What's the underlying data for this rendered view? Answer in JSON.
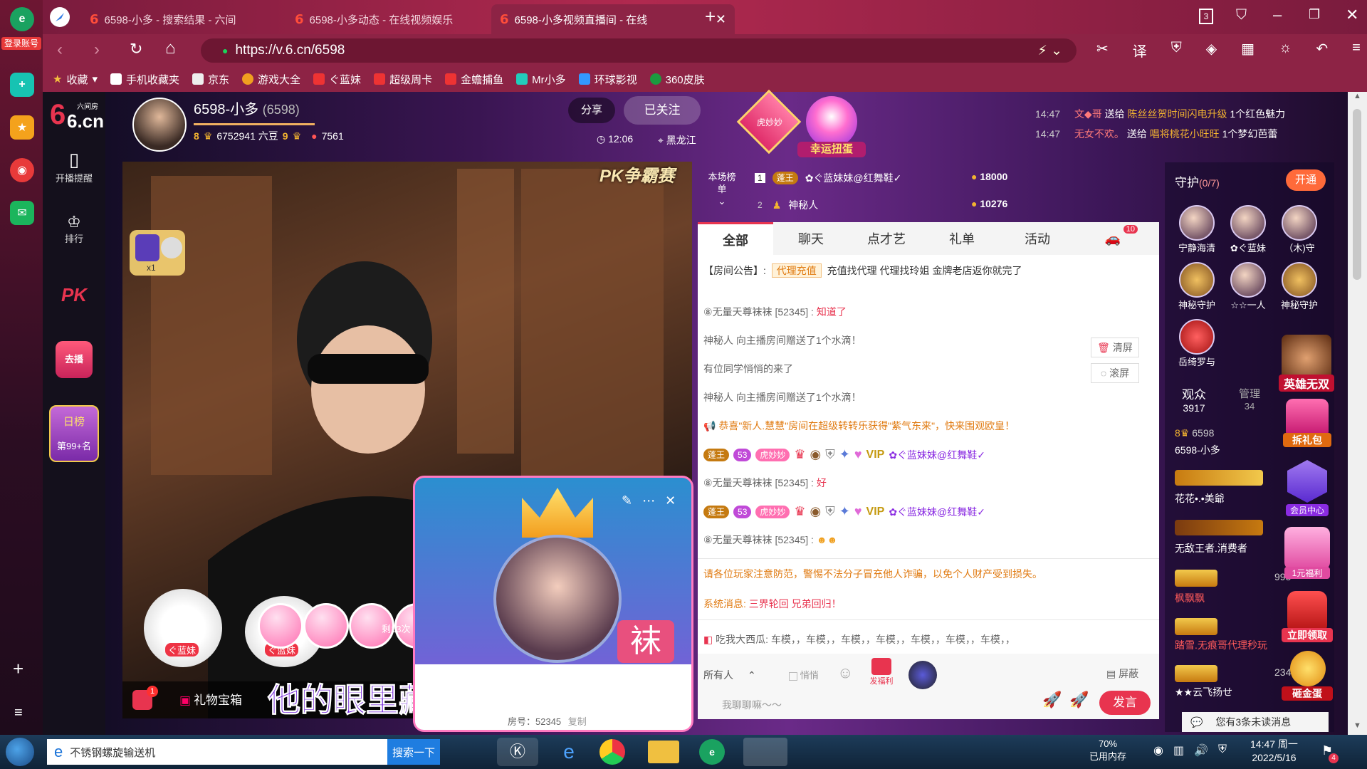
{
  "browser": {
    "tabs": [
      {
        "label": "6598-小多 - 搜索结果 - 六间",
        "active": false
      },
      {
        "label": "6598-小多动态 - 在线视频娱乐",
        "active": false
      },
      {
        "label": "6598-小多视频直播间 - 在线",
        "active": true
      }
    ],
    "url": "https://v.6.cn/6598",
    "tab_count": "3",
    "login_label": "登录账号",
    "bookmarks": [
      "收藏",
      "手机收藏夹",
      "京东",
      "游戏大全",
      "ぐ蓝妹",
      "超级周卡",
      "金蟾捕鱼",
      "Mr小多",
      "环球影视",
      "360皮肤"
    ]
  },
  "site": {
    "logo_main": "6.cn",
    "logo_small": "六间房",
    "nav": {
      "alert": "开播提醒",
      "rank": "排行",
      "pk": "PK",
      "live": "去播",
      "daily": "日榜",
      "daily_rank": "第99+名"
    }
  },
  "host": {
    "name": "6598-小多",
    "room_id": "(6598)",
    "level_left": "8",
    "beans": "6752941 六豆",
    "level_right": "9",
    "fans": "7561",
    "share_label": "分享",
    "follow_label": "已关注",
    "time": "12:06",
    "location": "黑龙江",
    "event_badge": "虎妙妙",
    "lucky_label": "幸运扭蛋"
  },
  "ticker": [
    {
      "time": "14:47",
      "sender": "文◆哥",
      "action": "送给",
      "receiver": "陈丝丝贺时间闪电升级",
      "gift": "1个红色魅力"
    },
    {
      "time": "14:47",
      "sender": "无女不欢。",
      "action": "送给",
      "receiver": "唱将桃花小旺旺",
      "gift": "1个梦幻芭蕾"
    }
  ],
  "ranking": {
    "label": "本场榜单",
    "rows": [
      {
        "rank": "1",
        "badge": "蓬王",
        "name": "✿ぐ蓝妹妹@红舞鞋✓",
        "score": "18000"
      },
      {
        "rank": "2",
        "badge": "",
        "name": "神秘人",
        "score": "10276"
      }
    ]
  },
  "chat": {
    "tabs": [
      "全部",
      "聊天",
      "点才艺",
      "礼单",
      "活动"
    ],
    "car_badge": "10",
    "notice_prefix": "【房间公告】:",
    "notice_tag": "代理充值",
    "notice_text": "充值找代理 代理找玲姐 金牌老店返你就完了",
    "lines": [
      {
        "type": "user",
        "name": "无量天尊袜袜 [52345]",
        "text": "知道了"
      },
      {
        "type": "system",
        "text": "神秘人 向主播房间赠送了1个水滴！"
      },
      {
        "type": "system",
        "text": "有位同学悄悄的来了"
      },
      {
        "type": "system",
        "text": "神秘人 向主播房间赠送了1个水滴！"
      },
      {
        "type": "congrats",
        "text": "恭喜\"新人.慧慧\"房间在超级转转乐获得\"紫气东来\"，快来围观欧皇！"
      },
      {
        "type": "badge_row",
        "badge": "蓬王",
        "level": "53",
        "tag": "虎妙妙",
        "name": "✿ぐ蓝妹妹@红舞鞋✓"
      },
      {
        "type": "user",
        "name": "无量天尊袜袜 [52345]",
        "text": "好"
      },
      {
        "type": "badge_row",
        "badge": "蓬王",
        "level": "53",
        "tag": "虎妙妙",
        "name": "✿ぐ蓝妹妹@红舞鞋✓"
      },
      {
        "type": "user",
        "name": "无量天尊袜袜 [52345]",
        "text": ""
      }
    ],
    "clear_label": "清屏",
    "scroll_label": "滚屏",
    "warning": "请各位玩家注意防范，警惕不法分子冒充他人诈骗，以免个人财产受到损失。",
    "sys_msg_prefix": "系统消息:",
    "sys_msg": "三界轮回 兄弟回归！",
    "broadcast_user": "吃我大西瓜",
    "broadcast_text": ": 车模，，车模，，车模，，车模，，车模，，车模，，车模，，",
    "recipient": "所有人",
    "whisper": "悄悄",
    "fuli": "发福利",
    "shield": "屏蔽",
    "input_placeholder": "我聊聊嘛～～",
    "send_label": "发言"
  },
  "guard": {
    "title": "守护",
    "count": "(0/7)",
    "open_label": "开通",
    "members": [
      "宁静海清",
      "✿ぐ蓝妹",
      "（木)守",
      "神秘守护",
      "☆☆一人",
      "神秘守护",
      "岳绮罗与"
    ]
  },
  "audience": {
    "tab_viewers": "观众",
    "viewers": "3917",
    "tab_admin": "管理",
    "admins": "34",
    "rows": [
      {
        "level": "8",
        "name": "6598-小多",
        "sub": "6598"
      },
      {
        "level": "",
        "name": "花花•.•美爺",
        "sub": ""
      },
      {
        "level": "",
        "name": "无敌王者.消费者",
        "sub": ""
      },
      {
        "level": "",
        "name": "枫飘飘",
        "sub": "995"
      },
      {
        "level": "",
        "name": "踏雪.无痕哥代理秒玩",
        "sub": ""
      },
      {
        "level": "",
        "name": "★★云飞扬せ",
        "sub": "2345"
      }
    ],
    "unread": "您有3条未读消息"
  },
  "promos": [
    "英雄无双",
    "拆礼包",
    "会员中心",
    "1元福利",
    "立即领取",
    "砸金蛋"
  ],
  "stage": {
    "seat1": "ぐ蓝妹",
    "seat2": "ぐ蓝妹",
    "remain": "剩13次",
    "gift_box": "礼物宝箱",
    "gift_count": "1",
    "pk_label": "PK争霸赛",
    "x1": "x1",
    "subtitle": "他的眼里藏着你的故事",
    "popup_room": "房号：52345",
    "popup_copy": "复制",
    "popup_name": "袜"
  },
  "taskbar": {
    "search_value": "不锈钢螺旋输送机",
    "search_btn": "搜索一下",
    "mem_percent": "70%",
    "mem_label": "已用内存",
    "time": "14:47 周一",
    "date": "2022/5/16",
    "flag_count": "4"
  },
  "colors": {
    "accent": "#e8344f",
    "gold": "#f2b330",
    "purple": "#6a2a88",
    "chrome": "#8d2345"
  }
}
